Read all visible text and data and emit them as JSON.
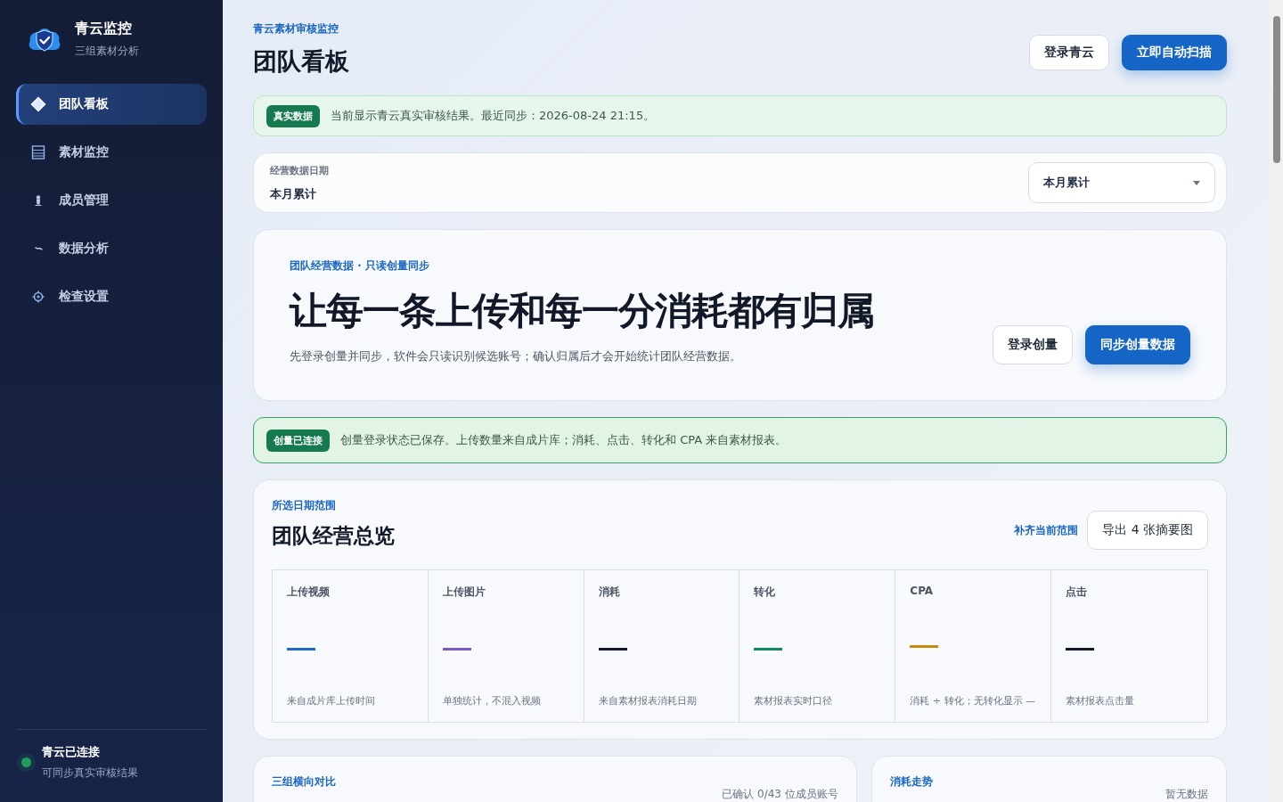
{
  "sidebar": {
    "brand": {
      "title": "青云监控",
      "subtitle": "三组素材分析"
    },
    "items": [
      {
        "label": "团队看板",
        "selected": true
      },
      {
        "label": "素材监控",
        "selected": false
      },
      {
        "label": "成员管理",
        "selected": false
      },
      {
        "label": "数据分析",
        "selected": false
      },
      {
        "label": "检查设置",
        "selected": false
      }
    ],
    "status": {
      "title": "青云已连接",
      "subtitle": "可同步真实审核结果",
      "color": "#1f9d5c"
    }
  },
  "header": {
    "eyebrow": "青云素材审核监控",
    "title": "团队看板",
    "buttons": [
      {
        "label": "登录青云",
        "kind": "secondary"
      },
      {
        "label": "立即自动扫描",
        "kind": "primary"
      }
    ]
  },
  "notice": {
    "badge": "真实数据",
    "text": "当前显示青云真实审核结果。最近同步：2026-08-24 21:15。"
  },
  "date_filter": {
    "label": "经营数据日期",
    "value": "本月累计",
    "select": "本月累计"
  },
  "hero": {
    "eyebrow": "团队经营数据 · 只读创量同步",
    "title": "让每一条上传和每一分消耗都有归属",
    "description": "先登录创量并同步，软件会只读识别候选账号；确认归属后才会开始统计团队经营数据。",
    "buttons": [
      {
        "label": "登录创量",
        "kind": "secondary"
      },
      {
        "label": "同步创量数据",
        "kind": "primary"
      }
    ]
  },
  "connection": {
    "badge": "创量已连接",
    "text": "创量登录状态已保存。上传数量来自成片库；消耗、点击、转化和 CPA 来自素材报表。"
  },
  "overview": {
    "eyebrow": "所选日期范围",
    "title": "团队经营总览",
    "link": "补齐当前范围",
    "button": "导出 4 张摘要图",
    "metrics": [
      {
        "label": "上传视频",
        "color": "#1e6bc6",
        "note": "来自成片库上传时间"
      },
      {
        "label": "上传图片",
        "color": "#7c5cc4",
        "note": "单独统计，不混入视频"
      },
      {
        "label": "消耗",
        "color": "#111827",
        "note": "来自素材报表消耗日期"
      },
      {
        "label": "转化",
        "color": "#0f8a5f",
        "note": "素材报表实时口径"
      },
      {
        "label": "CPA",
        "color": "#c98a0b",
        "note": "消耗 ÷ 转化；无转化显示 —"
      },
      {
        "label": "点击",
        "color": "#111827",
        "note": "素材报表点击量"
      }
    ]
  },
  "bottom_cards": [
    {
      "eyebrow": "三组横向对比",
      "meta": "已确认 0/43 位成员账号"
    },
    {
      "eyebrow": "消耗走势",
      "meta": "暂无数据"
    }
  ]
}
